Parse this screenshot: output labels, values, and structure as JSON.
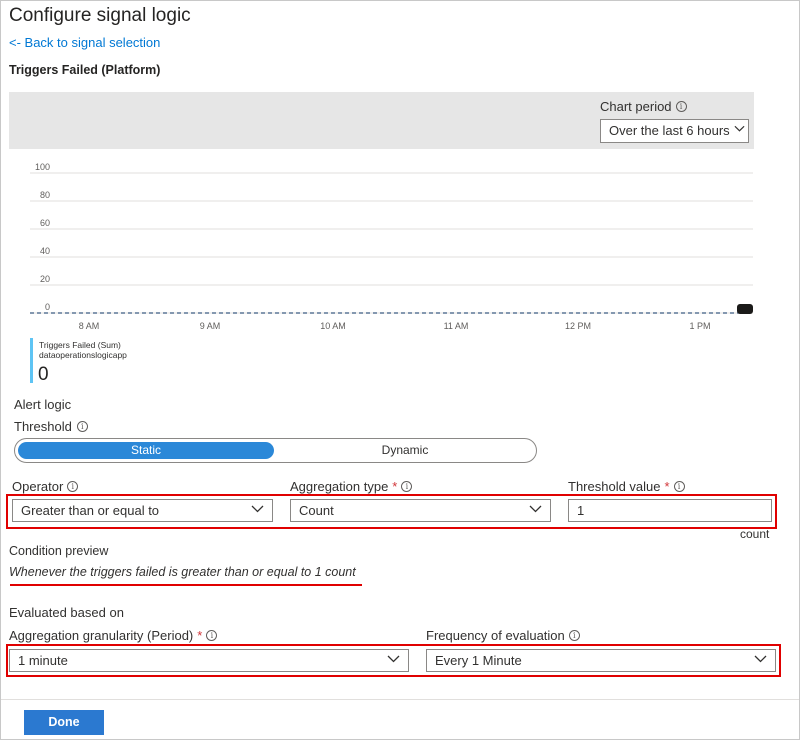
{
  "header": {
    "title": "Configure signal logic",
    "back_link": "<- Back to signal selection",
    "signal_name": "Triggers Failed (Platform)"
  },
  "chart_controls": {
    "period_label": "Chart period",
    "period_value": "Over the last 6 hours"
  },
  "chart_data": {
    "type": "line",
    "y_ticks": [
      "100",
      "80",
      "60",
      "40",
      "20",
      "0"
    ],
    "ylim": [
      0,
      100
    ],
    "x_ticks": [
      "8 AM",
      "9 AM",
      "10 AM",
      "11 AM",
      "12 PM",
      "1 PM"
    ],
    "series": [
      {
        "name": "Triggers Failed (Sum)",
        "values": [
          0,
          0,
          0,
          0,
          0,
          0,
          0
        ]
      }
    ],
    "grid": true
  },
  "legend": {
    "series_name": "Triggers Failed (Sum)",
    "resource": "dataoperationslogicapp",
    "value": "0",
    "color": "#5ec4f4"
  },
  "alert_logic": {
    "section_label": "Alert logic",
    "threshold_label": "Threshold",
    "threshold_options": [
      "Static",
      "Dynamic"
    ],
    "selected": "Static"
  },
  "fields": {
    "operator_label": "Operator",
    "operator_value": "Greater than or equal to",
    "aggregation_label": "Aggregation type",
    "aggregation_value": "Count",
    "threshold_value_label": "Threshold value",
    "threshold_value": "1",
    "threshold_unit": "count",
    "required_mark": "*"
  },
  "condition": {
    "label": "Condition preview",
    "text": "Whenever the triggers failed is greater than or equal to 1 count"
  },
  "evaluation": {
    "section_label": "Evaluated based on",
    "granularity_label": "Aggregation granularity (Period)",
    "granularity_value": "1 minute",
    "frequency_label": "Frequency of evaluation",
    "frequency_value": "Every 1 Minute"
  },
  "footer": {
    "done_label": "Done"
  },
  "colors": {
    "accent": "#0078d4",
    "highlight": "#e00000",
    "button": "#2b79d0"
  },
  "icons": {
    "info": "info-circle-icon",
    "chevron": "chevron-down-icon"
  }
}
